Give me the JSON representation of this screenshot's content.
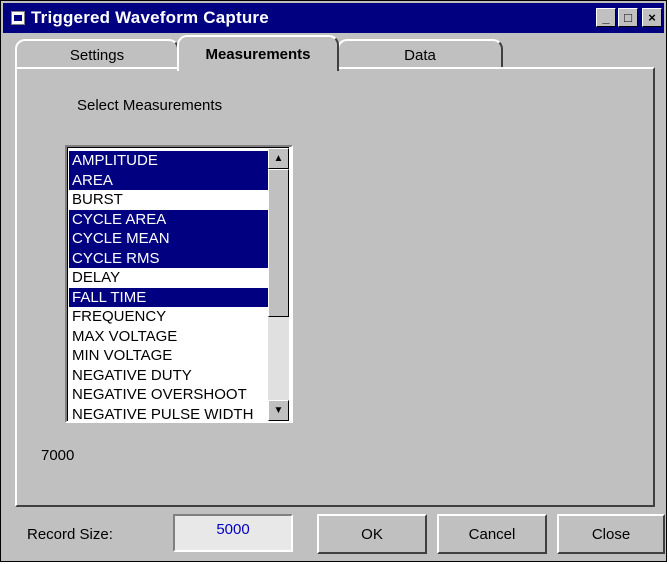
{
  "window": {
    "title": "Triggered Waveform Capture",
    "minimize_glyph": "_",
    "maximize_glyph": "□",
    "close_glyph": "×"
  },
  "tabs": [
    {
      "label": "Settings",
      "active": false
    },
    {
      "label": "Measurements",
      "active": true
    },
    {
      "label": "Data",
      "active": false
    }
  ],
  "measurements": {
    "section_label": "Select Measurements",
    "items": [
      {
        "label": "AMPLITUDE",
        "selected": true
      },
      {
        "label": "AREA",
        "selected": true
      },
      {
        "label": "BURST",
        "selected": false
      },
      {
        "label": "CYCLE AREA",
        "selected": true
      },
      {
        "label": "CYCLE MEAN",
        "selected": true
      },
      {
        "label": "CYCLE RMS",
        "selected": true
      },
      {
        "label": "DELAY",
        "selected": false
      },
      {
        "label": "FALL TIME",
        "selected": true
      },
      {
        "label": "FREQUENCY",
        "selected": false
      },
      {
        "label": "MAX VOLTAGE",
        "selected": false
      },
      {
        "label": "MIN VOLTAGE",
        "selected": false
      },
      {
        "label": "NEGATIVE DUTY",
        "selected": false
      },
      {
        "label": "NEGATIVE OVERSHOOT",
        "selected": false
      },
      {
        "label": "NEGATIVE PULSE WIDTH",
        "selected": false
      }
    ],
    "value_display": "7000"
  },
  "footer": {
    "record_size_label": "Record Size:",
    "record_size_value": "5000",
    "ok_label": "OK",
    "cancel_label": "Cancel",
    "close_label": "Close"
  },
  "colors": {
    "title_bar": "#000080",
    "selection": "#000080",
    "face": "#c0c0c0",
    "record_value": "#0000c0"
  }
}
